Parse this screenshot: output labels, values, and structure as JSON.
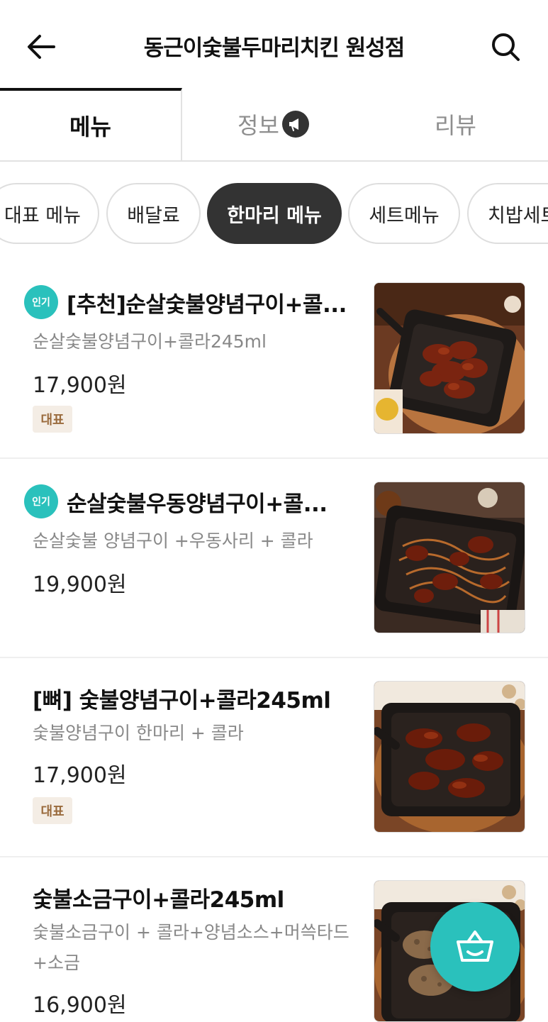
{
  "header": {
    "title": "동근이숯불두마리치킨 원성점"
  },
  "tabs": [
    {
      "label": "메뉴"
    },
    {
      "label": "정보"
    },
    {
      "label": "리뷰"
    }
  ],
  "chips": [
    {
      "label": "대표 메뉴"
    },
    {
      "label": "배달료"
    },
    {
      "label": "한마리 메뉴"
    },
    {
      "label": "세트메뉴"
    },
    {
      "label": "치밥세트"
    }
  ],
  "badges": {
    "popular": "인기",
    "representative": "대표"
  },
  "menu": [
    {
      "name": "[추천]순살숯불양념구이+콜...",
      "desc": "순살숯불양념구이+콜라245ml",
      "price": "17,900원",
      "popular": true,
      "representative": true
    },
    {
      "name": "순살숯불우동양념구이+콜...",
      "desc": "순살숯불 양념구이 +우동사리 + 콜라",
      "price": "19,900원",
      "popular": true,
      "representative": false
    },
    {
      "name": "[뼈] 숯불양념구이+콜라245ml",
      "desc": "숯불양념구이 한마리 + 콜라",
      "price": "17,900원",
      "popular": false,
      "representative": true
    },
    {
      "name": "숯불소금구이+콜라245ml",
      "desc": "숯불소금구이 + 콜라+양념소스+머쓱타드+소금",
      "price": "16,900원",
      "popular": false,
      "representative": false
    }
  ],
  "colors": {
    "accent": "#2ac1bc",
    "chip_active": "#333333"
  },
  "icons": {
    "back": "arrow-left-icon",
    "search": "search-icon",
    "info": "megaphone-icon",
    "cart": "basket-icon"
  }
}
